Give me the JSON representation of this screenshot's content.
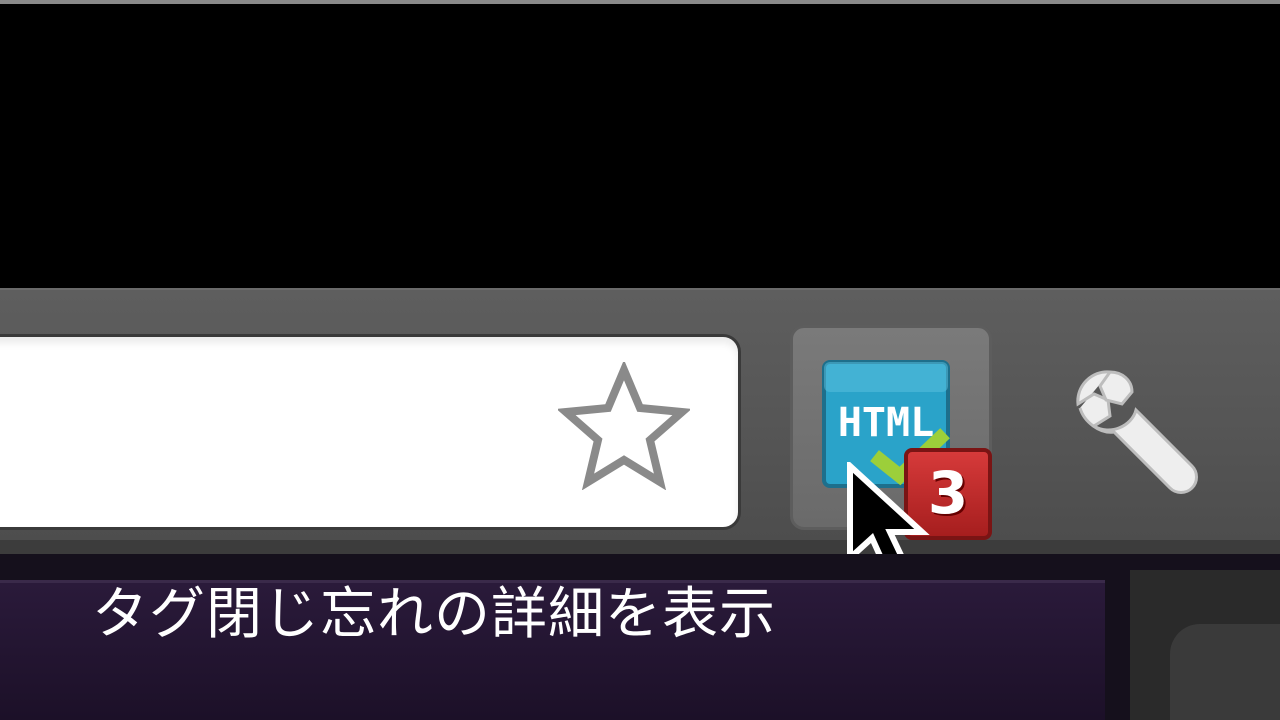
{
  "toolbar": {
    "star_icon": "star-outline-icon",
    "extension": {
      "icon": "html-validator-icon",
      "icon_text": "HTML",
      "badge_count": "3",
      "badge_color": "#c62828"
    },
    "wrench_icon": "wrench-icon"
  },
  "caption": {
    "text": "タグ閉じ忘れの詳細を表示"
  },
  "colors": {
    "toolbar": "#555555",
    "omnibox": "#ffffff",
    "extension_icon": "#2aa3c9",
    "badge": "#c62828"
  }
}
